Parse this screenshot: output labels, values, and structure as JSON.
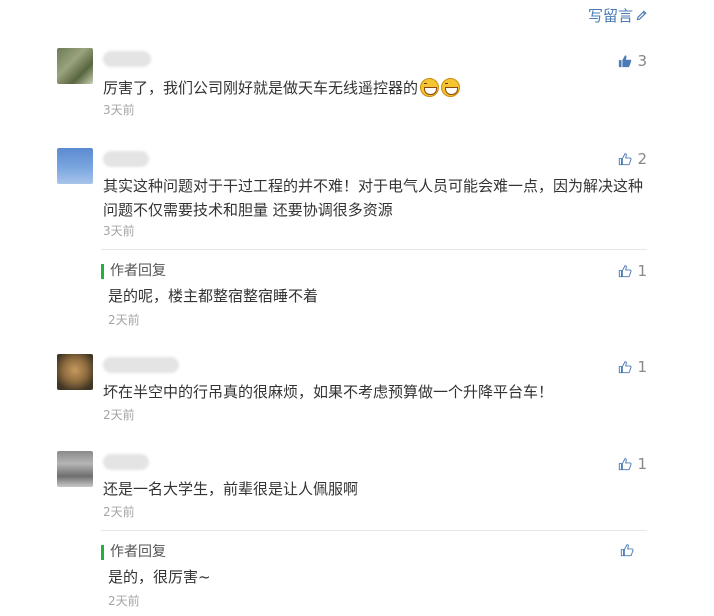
{
  "header": {
    "write_label": "写留言"
  },
  "comments": [
    {
      "text": "厉害了，我们公司刚好就是做天车无线遥控器的",
      "emoji_count": 2,
      "time": "3天前",
      "likes": "3"
    },
    {
      "text": "其实这种问题对于干过工程的并不难！对于电气人员可能会难一点，因为解决这种问题不仅需要技术和胆量 还要协调很多资源",
      "time": "3天前",
      "likes": "2",
      "reply": {
        "title": "作者回复",
        "text": "是的呢，楼主都整宿整宿睡不着",
        "time": "2天前",
        "likes": "1"
      }
    },
    {
      "text": "坏在半空中的行吊真的很麻烦，如果不考虑预算做一个升降平台车！",
      "time": "2天前",
      "likes": "1"
    },
    {
      "text": "还是一名大学生，前辈很是让人佩服啊",
      "time": "2天前",
      "likes": "1",
      "reply": {
        "title": "作者回复",
        "text": "是的，很厉害~",
        "time": "2天前",
        "likes": ""
      }
    }
  ],
  "colors": {
    "link": "#4a7bb5",
    "author_bar": "#21b045",
    "muted": "#a5a5a5"
  },
  "icons": {
    "write": "pencil-icon",
    "like": "thumb-up-icon"
  }
}
